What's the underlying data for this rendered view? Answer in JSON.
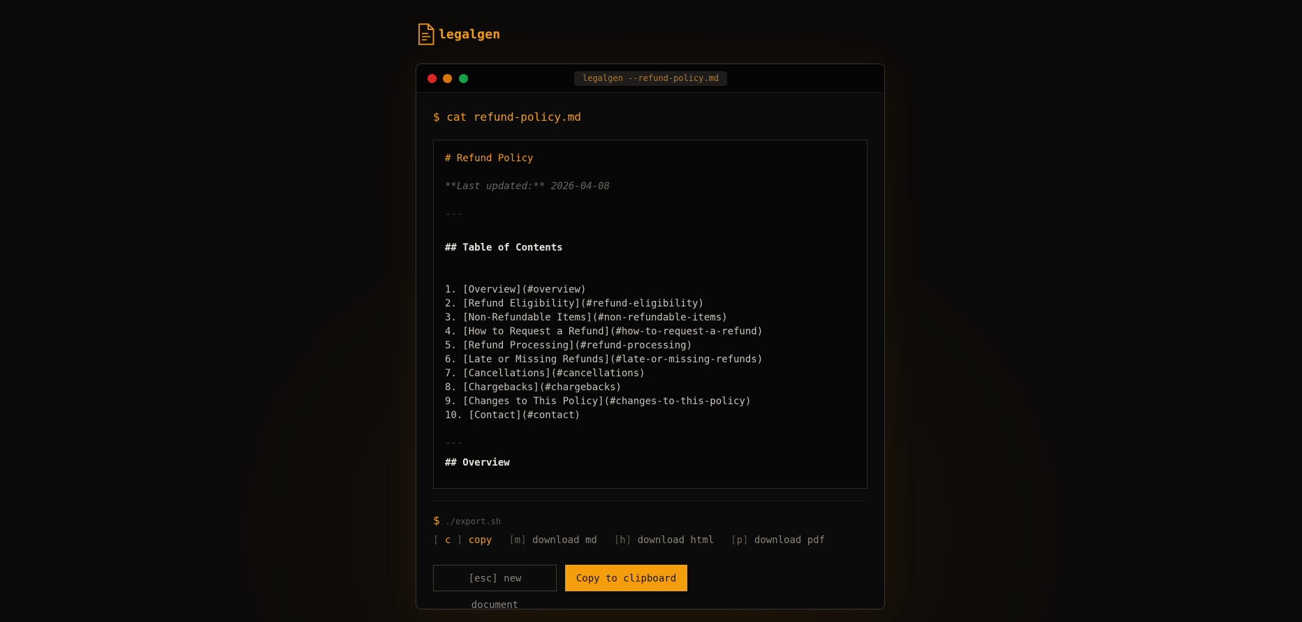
{
  "brand": {
    "name": "legalgen",
    "icon": "document-icon",
    "accent": "#f59e0b"
  },
  "window": {
    "title": "legalgen --refund-policy.md"
  },
  "command": "$ cat refund-policy.md",
  "document": {
    "h1": "# Refund Policy",
    "meta": "**Last updated:** 2026-04-08",
    "rule": "---",
    "toc_heading": "## Table of Contents",
    "toc_items": [
      "1. [Overview](#overview)",
      "2. [Refund Eligibility](#refund-eligibility)",
      "3. [Non-Refundable Items](#non-refundable-items)",
      "4. [How to Request a Refund](#how-to-request-a-refund)",
      "5. [Refund Processing](#refund-processing)",
      "6. [Late or Missing Refunds](#late-or-missing-refunds)",
      "7. [Cancellations](#cancellations)",
      "8. [Chargebacks](#chargebacks)",
      "9. [Changes to This Policy](#changes-to-this-policy)",
      "10. [Contact](#contact)"
    ],
    "rule2": "---",
    "overview_heading": "## Overview"
  },
  "export": {
    "prompt": "$",
    "script": "./export.sh"
  },
  "shortcuts": [
    {
      "key": "c",
      "label": "copy",
      "active": true
    },
    {
      "key": "m",
      "label": "download md",
      "active": false
    },
    {
      "key": "h",
      "label": "download html",
      "active": false
    },
    {
      "key": "p",
      "label": "download pdf",
      "active": false
    }
  ],
  "buttons": {
    "new_document": "[esc] new document",
    "copy": "Copy to clipboard"
  }
}
